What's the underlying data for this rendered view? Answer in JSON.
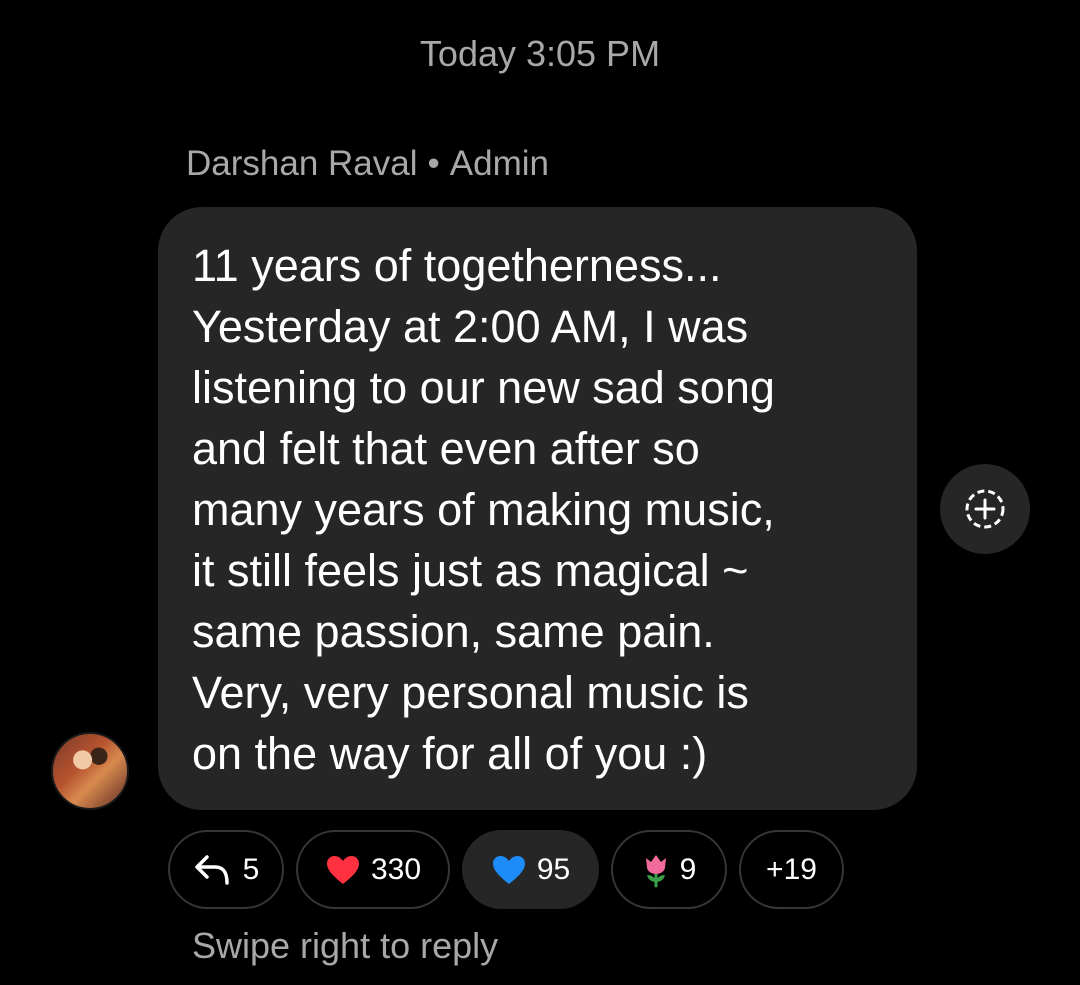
{
  "timestamp": "Today 3:05 PM",
  "message": {
    "sender": "Darshan Raval",
    "separator": "•",
    "role": "Admin",
    "lines": [
      "11 years of togetherness...",
      "Yesterday at 2:00 AM, I was",
      "listening to our new sad song",
      "and felt that even after so",
      "many years of making music,",
      "it still feels just as magical ~",
      "same passion, same pain.",
      "Very, very personal music is",
      "on the way for all of you :)"
    ]
  },
  "reactions": {
    "replies": "5",
    "heart_red": {
      "emoji": "❤️",
      "count": "330"
    },
    "heart_blue": {
      "emoji": "💙",
      "count": "95"
    },
    "tulip": {
      "emoji": "🌷",
      "count": "9"
    },
    "more": "+19"
  },
  "hint": "Swipe right to reply",
  "icons": {
    "reply": "reply-arrow-icon",
    "add_reaction": "add-reaction-icon"
  },
  "colors": {
    "background": "#000000",
    "bubble": "#262626",
    "secondary_text": "#a8a8a8",
    "chip_border": "#363636",
    "heart_red": "#ff3040",
    "heart_blue": "#1d8cf8"
  }
}
